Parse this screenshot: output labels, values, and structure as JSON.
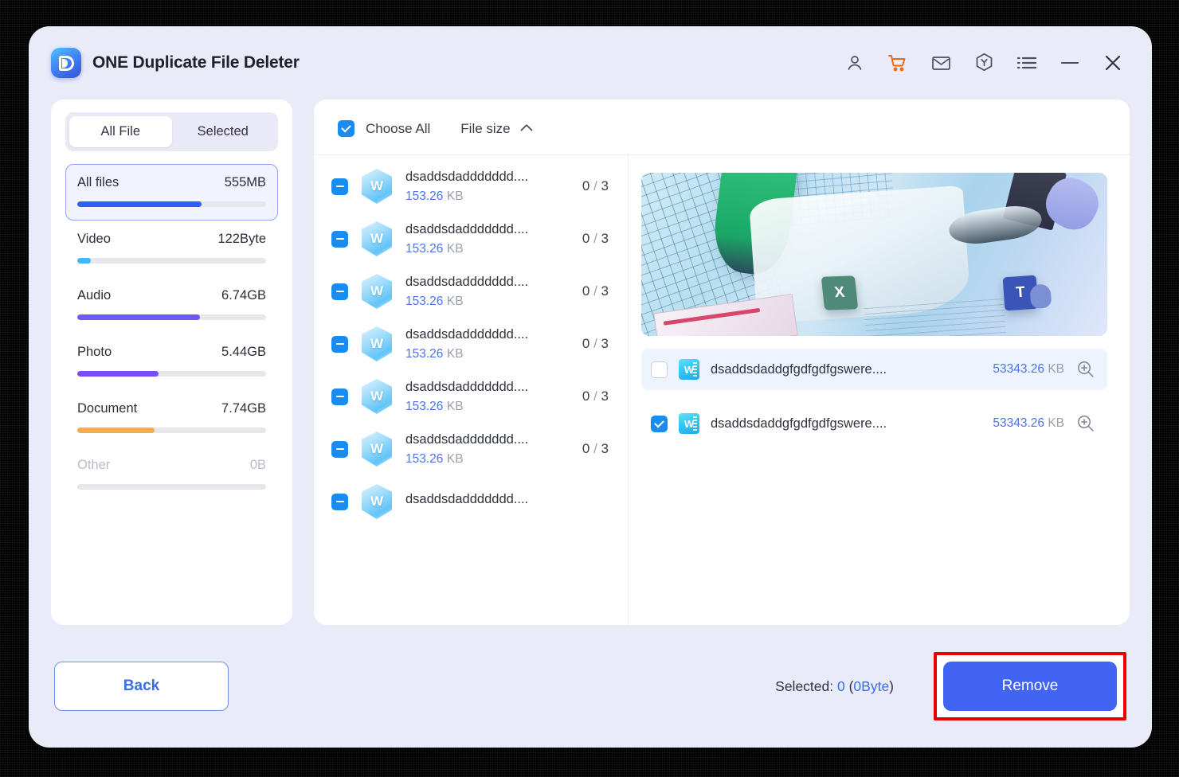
{
  "app": {
    "title": "ONE Duplicate File Deleter",
    "logo_icon": "droplet-d-logo"
  },
  "header": {
    "icons": [
      {
        "name": "account-icon",
        "label": "Account"
      },
      {
        "name": "cart-icon",
        "label": "Store",
        "color": "#f2690d"
      },
      {
        "name": "mail-icon",
        "label": "Mail"
      },
      {
        "name": "award-hexagon-icon",
        "label": "Rewards"
      },
      {
        "name": "menu-list-icon",
        "label": "Menu"
      },
      {
        "name": "minimize-icon",
        "label": "Minimize"
      },
      {
        "name": "close-icon",
        "label": "Close"
      }
    ]
  },
  "sidebar": {
    "tabs": [
      {
        "label": "All File",
        "active": true
      },
      {
        "label": "Selected",
        "active": false
      }
    ],
    "categories": [
      {
        "name": "All files",
        "size": "555MB",
        "percent": 66,
        "color": "#2f5ff5",
        "selected": true,
        "muted": false
      },
      {
        "name": "Video",
        "size": "122Byte",
        "percent": 7,
        "color": "#3fb8f5",
        "selected": false,
        "muted": false
      },
      {
        "name": "Audio",
        "size": "6.74GB",
        "percent": 65,
        "color": "#6b5bf0",
        "selected": false,
        "muted": false
      },
      {
        "name": "Photo",
        "size": "5.44GB",
        "percent": 43,
        "color": "#7b4df4",
        "selected": false,
        "muted": false
      },
      {
        "name": "Document",
        "size": "7.74GB",
        "percent": 41,
        "color": "#f5ad54",
        "selected": false,
        "muted": false
      },
      {
        "name": "Other",
        "size": "0B",
        "percent": 0,
        "color": "#e6e7ea",
        "selected": false,
        "muted": true
      }
    ]
  },
  "toolbar": {
    "choose_all_label": "Choose All",
    "choose_all_checked": true,
    "sort_label": "File size",
    "sort_direction_icon": "chevron-up-icon"
  },
  "file_list": {
    "rows": [
      {
        "name": "dsaddsdaddddddd....",
        "size_value": "153.26",
        "size_unit": "KB",
        "count_selected": "0",
        "count_total": "3",
        "state": "indeterminate"
      },
      {
        "name": "dsaddsdaddddddd....",
        "size_value": "153.26",
        "size_unit": "KB",
        "count_selected": "0",
        "count_total": "3",
        "state": "indeterminate"
      },
      {
        "name": "dsaddsdaddddddd....",
        "size_value": "153.26",
        "size_unit": "KB",
        "count_selected": "0",
        "count_total": "3",
        "state": "indeterminate"
      },
      {
        "name": "dsaddsdaddddddd....",
        "size_value": "153.26",
        "size_unit": "KB",
        "count_selected": "0",
        "count_total": "3",
        "state": "indeterminate"
      },
      {
        "name": "dsaddsdaddddddd....",
        "size_value": "153.26",
        "size_unit": "KB",
        "count_selected": "0",
        "count_total": "3",
        "state": "indeterminate"
      },
      {
        "name": "dsaddsdaddddddd....",
        "size_value": "153.26",
        "size_unit": "KB",
        "count_selected": "0",
        "count_total": "3",
        "state": "indeterminate"
      },
      {
        "name": "dsaddsdaddddddd....",
        "size_value": "",
        "size_unit": "",
        "count_selected": "",
        "count_total": "",
        "state": "indeterminate"
      }
    ]
  },
  "detail": {
    "preview_alt": "office-documents-preview-image",
    "preview_tiles": {
      "excel": "X",
      "teams": "T"
    },
    "duplicates": [
      {
        "name": "dsaddsdaddgfgdfgdfgswere....",
        "size_value": "53343.26",
        "size_unit": "KB",
        "checked": false,
        "highlighted": true
      },
      {
        "name": "dsaddsdaddgfgdfgdfgswere....",
        "size_value": "53343.26",
        "size_unit": "KB",
        "checked": true,
        "highlighted": false
      }
    ]
  },
  "footer": {
    "back_label": "Back",
    "selected_prefix": "Selected: ",
    "selected_count": "0",
    "selected_size": "0Byte",
    "remove_label": "Remove"
  }
}
